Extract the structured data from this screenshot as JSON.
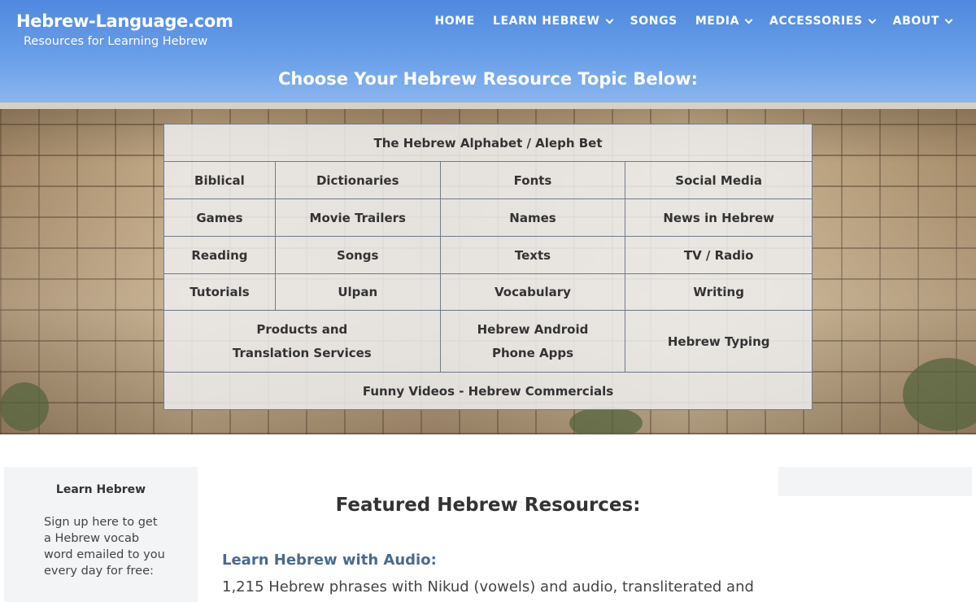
{
  "header": {
    "site_title": "Hebrew-Language.com",
    "tagline": "Resources for Learning Hebrew",
    "nav": [
      {
        "label": "HOME",
        "dropdown": false
      },
      {
        "label": "LEARN HEBREW",
        "dropdown": true
      },
      {
        "label": "SONGS",
        "dropdown": false
      },
      {
        "label": "MEDIA",
        "dropdown": true
      },
      {
        "label": "ACCESSORIES",
        "dropdown": true
      },
      {
        "label": "ABOUT",
        "dropdown": true
      }
    ]
  },
  "hero": {
    "heading": "Choose Your Hebrew Resource Topic Below:"
  },
  "topics": {
    "top": "The Hebrew Alphabet / Aleph Bet",
    "row1": [
      "Biblical",
      "Dictionaries",
      "Fonts",
      "Social Media"
    ],
    "row2": [
      "Games",
      "Movie Trailers",
      "Names",
      "News in Hebrew"
    ],
    "row3": [
      "Reading",
      "Songs",
      "Texts",
      "TV / Radio"
    ],
    "row4": [
      "Tutorials",
      "Ulpan",
      "Vocabulary",
      "Writing"
    ],
    "products_line1": "Products and",
    "products_line2": "Translation Services",
    "android_line1": "Hebrew Android",
    "android_line2": "Phone Apps",
    "typing": "Hebrew Typing",
    "bottom": "Funny Videos - Hebrew Commercials"
  },
  "sidebar": {
    "title": "Learn Hebrew",
    "text": "Sign up here to get a Hebrew vocab word emailed to you every day for free:"
  },
  "main": {
    "featured_title": "Featured Hebrew Resources:",
    "audio_heading": "Learn Hebrew with Audio:",
    "audio_text": "1,215 Hebrew phrases with Nikud (vowels) and audio, transliterated and"
  },
  "colors": {
    "sky": "#5b92e2",
    "link_heading": "#4a6a8e",
    "table_border": "#707a8c"
  }
}
